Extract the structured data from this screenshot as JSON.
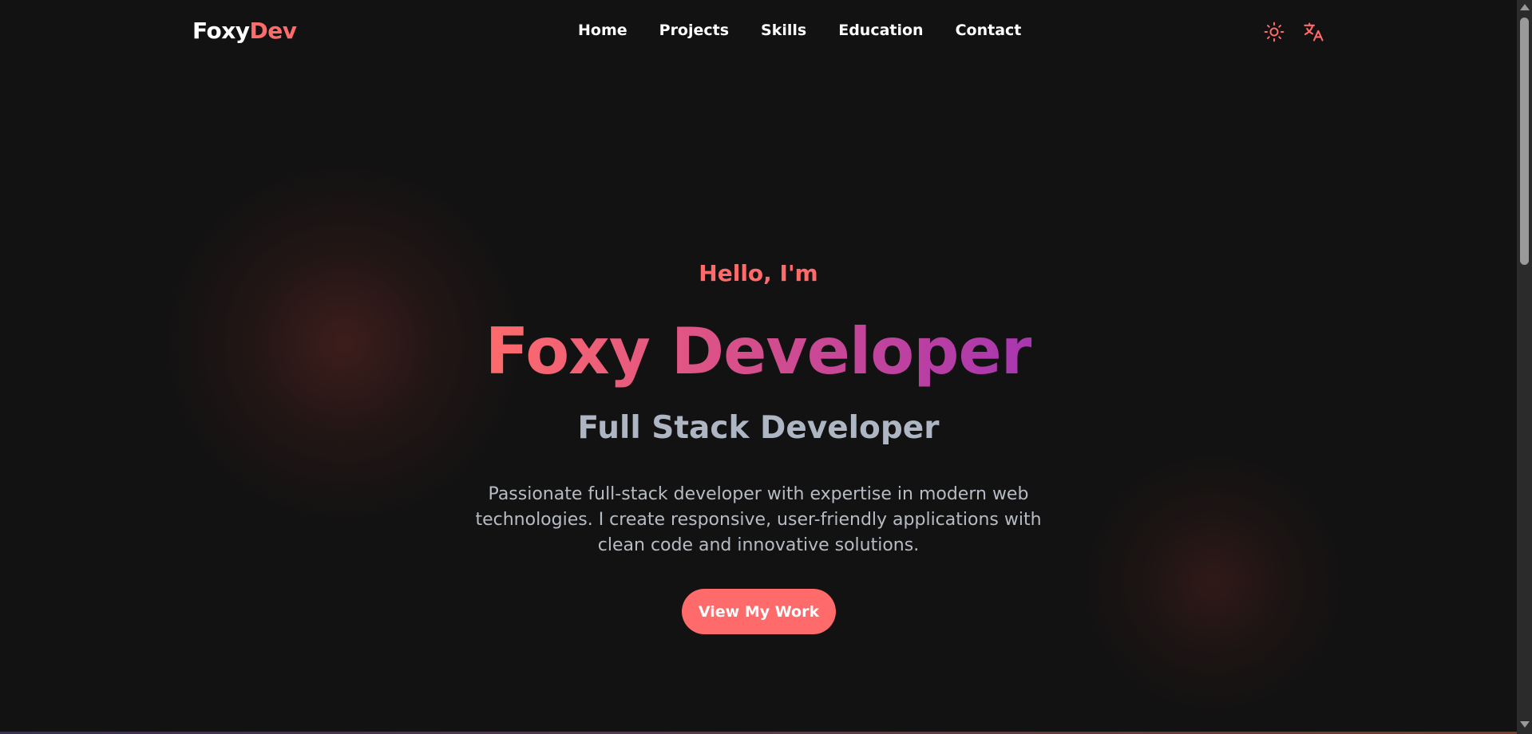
{
  "brand": {
    "logo_part_a": "Foxy",
    "logo_part_b": "Dev"
  },
  "nav": {
    "links": [
      {
        "label": "Home"
      },
      {
        "label": "Projects"
      },
      {
        "label": "Skills"
      },
      {
        "label": "Education"
      },
      {
        "label": "Contact"
      }
    ]
  },
  "controls": {
    "theme_icon": "sun-icon",
    "language_icon": "translate-icon"
  },
  "hero": {
    "greeting": "Hello, I'm",
    "name": "Foxy Developer",
    "role": "Full Stack Developer",
    "description": "Passionate full-stack developer with expertise in modern web technologies. I create responsive, user-friendly applications with clean code and innovative solutions.",
    "cta_label": "View My Work"
  },
  "colors": {
    "background": "#121212",
    "accent": "#ff6b6b",
    "gradient_end": "#a836b0",
    "role_text": "#adb6c2",
    "body_text": "#b7bcc4"
  }
}
